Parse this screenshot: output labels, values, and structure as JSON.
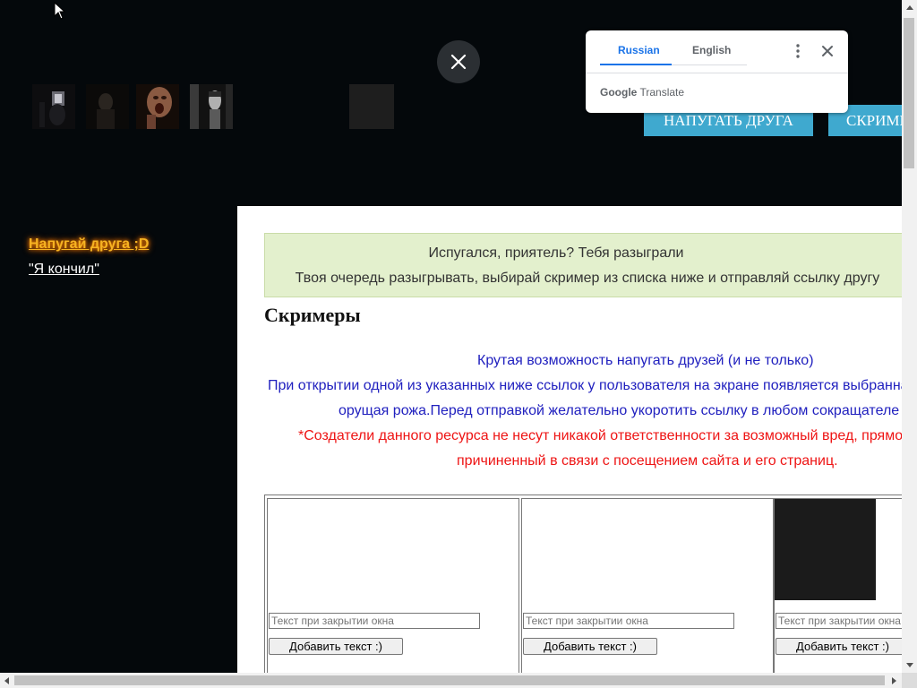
{
  "header": {
    "thumbnails": [
      {
        "name": "dark-room-thumbnail"
      },
      {
        "name": "dark-figure-thumbnail"
      },
      {
        "name": "screaming-face-thumbnail"
      },
      {
        "name": "ghost-girl-thumbnail"
      }
    ],
    "buttons": [
      {
        "label": "НАПУГАТЬ ДРУГА"
      },
      {
        "label": "СКРИМЕРЫ"
      }
    ]
  },
  "sidebar": {
    "links": [
      {
        "label": " Напугай друга ;D"
      },
      {
        "label": " \"Я кончил\""
      }
    ]
  },
  "main": {
    "banner": {
      "line1": "Испугался, приятель? Тебя разыграли",
      "line2": "Твоя очередь разыгрывать, выбирай скример из списка ниже и отправляй ссылку другу"
    },
    "title": "Скримеры",
    "description": [
      "Крутая возможность напугать друзей (и не только)",
      "При открытии одной из указанных ниже ссылок у пользователя на экране появляется выбранная",
      "орущая рожа.Перед отправкой желательно укоротить ссылку в любом сокращателе"
    ],
    "disclaimer": [
      "*Создатели данного ресурса не несут никакой ответственности за возможный вред, прямой или косвенный,",
      "причиненный в связи с посещением сайта и его страниц."
    ],
    "cards": [
      {
        "placeholder": "Текст при закрытии окна",
        "button": "Добавить текст :)"
      },
      {
        "placeholder": "Текст при закрытии окна",
        "button": "Добавить текст :)"
      },
      {
        "placeholder": "Текст при закрытии окна",
        "button": "Добавить текст :)"
      }
    ]
  },
  "translate_popup": {
    "tabs": [
      {
        "label": "Russian"
      },
      {
        "label": "English"
      }
    ],
    "brand_google": "Google",
    "brand_translate": "Translate",
    "accent_color": "#1a73e8"
  },
  "colors": {
    "page_background": "#04080b",
    "header_button": "#3fa9cf",
    "sidebar_link_highlight": "#f6b322",
    "banner_background": "#e3f0cd",
    "description_text": "#2121bf",
    "disclaimer_text": "#ee1414"
  }
}
